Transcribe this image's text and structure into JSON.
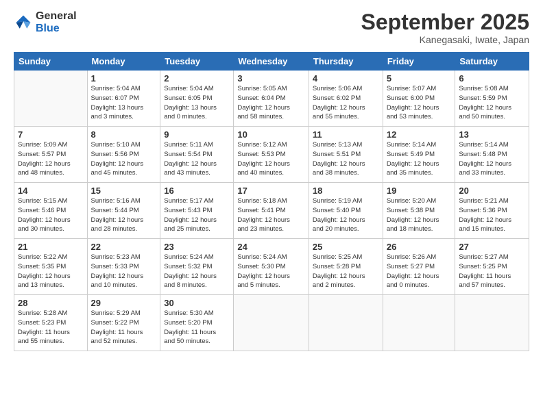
{
  "logo": {
    "line1": "General",
    "line2": "Blue"
  },
  "title": "September 2025",
  "location": "Kanegasaki, Iwate, Japan",
  "weekdays": [
    "Sunday",
    "Monday",
    "Tuesday",
    "Wednesday",
    "Thursday",
    "Friday",
    "Saturday"
  ],
  "weeks": [
    [
      {
        "day": "",
        "info": ""
      },
      {
        "day": "1",
        "info": "Sunrise: 5:04 AM\nSunset: 6:07 PM\nDaylight: 13 hours\nand 3 minutes."
      },
      {
        "day": "2",
        "info": "Sunrise: 5:04 AM\nSunset: 6:05 PM\nDaylight: 13 hours\nand 0 minutes."
      },
      {
        "day": "3",
        "info": "Sunrise: 5:05 AM\nSunset: 6:04 PM\nDaylight: 12 hours\nand 58 minutes."
      },
      {
        "day": "4",
        "info": "Sunrise: 5:06 AM\nSunset: 6:02 PM\nDaylight: 12 hours\nand 55 minutes."
      },
      {
        "day": "5",
        "info": "Sunrise: 5:07 AM\nSunset: 6:00 PM\nDaylight: 12 hours\nand 53 minutes."
      },
      {
        "day": "6",
        "info": "Sunrise: 5:08 AM\nSunset: 5:59 PM\nDaylight: 12 hours\nand 50 minutes."
      }
    ],
    [
      {
        "day": "7",
        "info": "Sunrise: 5:09 AM\nSunset: 5:57 PM\nDaylight: 12 hours\nand 48 minutes."
      },
      {
        "day": "8",
        "info": "Sunrise: 5:10 AM\nSunset: 5:56 PM\nDaylight: 12 hours\nand 45 minutes."
      },
      {
        "day": "9",
        "info": "Sunrise: 5:11 AM\nSunset: 5:54 PM\nDaylight: 12 hours\nand 43 minutes."
      },
      {
        "day": "10",
        "info": "Sunrise: 5:12 AM\nSunset: 5:53 PM\nDaylight: 12 hours\nand 40 minutes."
      },
      {
        "day": "11",
        "info": "Sunrise: 5:13 AM\nSunset: 5:51 PM\nDaylight: 12 hours\nand 38 minutes."
      },
      {
        "day": "12",
        "info": "Sunrise: 5:14 AM\nSunset: 5:49 PM\nDaylight: 12 hours\nand 35 minutes."
      },
      {
        "day": "13",
        "info": "Sunrise: 5:14 AM\nSunset: 5:48 PM\nDaylight: 12 hours\nand 33 minutes."
      }
    ],
    [
      {
        "day": "14",
        "info": "Sunrise: 5:15 AM\nSunset: 5:46 PM\nDaylight: 12 hours\nand 30 minutes."
      },
      {
        "day": "15",
        "info": "Sunrise: 5:16 AM\nSunset: 5:44 PM\nDaylight: 12 hours\nand 28 minutes."
      },
      {
        "day": "16",
        "info": "Sunrise: 5:17 AM\nSunset: 5:43 PM\nDaylight: 12 hours\nand 25 minutes."
      },
      {
        "day": "17",
        "info": "Sunrise: 5:18 AM\nSunset: 5:41 PM\nDaylight: 12 hours\nand 23 minutes."
      },
      {
        "day": "18",
        "info": "Sunrise: 5:19 AM\nSunset: 5:40 PM\nDaylight: 12 hours\nand 20 minutes."
      },
      {
        "day": "19",
        "info": "Sunrise: 5:20 AM\nSunset: 5:38 PM\nDaylight: 12 hours\nand 18 minutes."
      },
      {
        "day": "20",
        "info": "Sunrise: 5:21 AM\nSunset: 5:36 PM\nDaylight: 12 hours\nand 15 minutes."
      }
    ],
    [
      {
        "day": "21",
        "info": "Sunrise: 5:22 AM\nSunset: 5:35 PM\nDaylight: 12 hours\nand 13 minutes."
      },
      {
        "day": "22",
        "info": "Sunrise: 5:23 AM\nSunset: 5:33 PM\nDaylight: 12 hours\nand 10 minutes."
      },
      {
        "day": "23",
        "info": "Sunrise: 5:24 AM\nSunset: 5:32 PM\nDaylight: 12 hours\nand 8 minutes."
      },
      {
        "day": "24",
        "info": "Sunrise: 5:24 AM\nSunset: 5:30 PM\nDaylight: 12 hours\nand 5 minutes."
      },
      {
        "day": "25",
        "info": "Sunrise: 5:25 AM\nSunset: 5:28 PM\nDaylight: 12 hours\nand 2 minutes."
      },
      {
        "day": "26",
        "info": "Sunrise: 5:26 AM\nSunset: 5:27 PM\nDaylight: 12 hours\nand 0 minutes."
      },
      {
        "day": "27",
        "info": "Sunrise: 5:27 AM\nSunset: 5:25 PM\nDaylight: 11 hours\nand 57 minutes."
      }
    ],
    [
      {
        "day": "28",
        "info": "Sunrise: 5:28 AM\nSunset: 5:23 PM\nDaylight: 11 hours\nand 55 minutes."
      },
      {
        "day": "29",
        "info": "Sunrise: 5:29 AM\nSunset: 5:22 PM\nDaylight: 11 hours\nand 52 minutes."
      },
      {
        "day": "30",
        "info": "Sunrise: 5:30 AM\nSunset: 5:20 PM\nDaylight: 11 hours\nand 50 minutes."
      },
      {
        "day": "",
        "info": ""
      },
      {
        "day": "",
        "info": ""
      },
      {
        "day": "",
        "info": ""
      },
      {
        "day": "",
        "info": ""
      }
    ]
  ]
}
